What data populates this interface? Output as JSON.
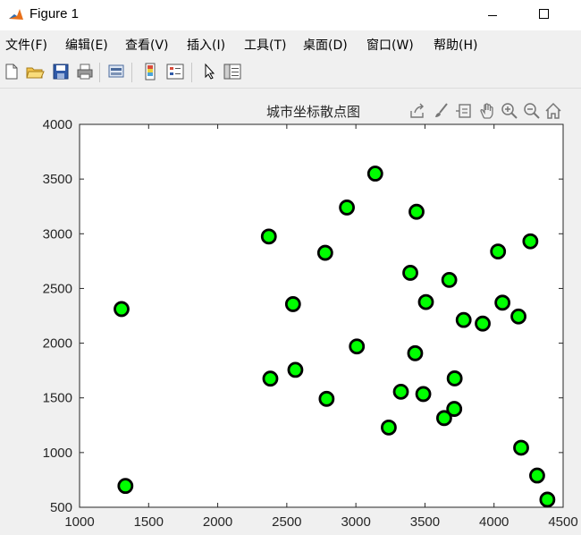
{
  "window": {
    "title": "Figure 1",
    "icon": "matlab-icon",
    "controls": [
      "minimize-icon",
      "maximize-icon"
    ]
  },
  "menu": [
    {
      "label": "文件(F)"
    },
    {
      "label": "编辑(E)"
    },
    {
      "label": "查看(V)"
    },
    {
      "label": "插入(I)"
    },
    {
      "label": "工具(T)"
    },
    {
      "label": "桌面(D)"
    },
    {
      "label": "窗口(W)"
    },
    {
      "label": "帮助(H)"
    }
  ],
  "toolbar": [
    "new-figure-icon",
    "open-file-icon",
    "save-icon",
    "print-icon",
    "link-plot-icon",
    "insert-colorbar-icon",
    "insert-legend-icon",
    "edit-plot-arrow-icon",
    "property-inspector-icon"
  ],
  "axes_toolbar": [
    "export-icon",
    "brush-icon",
    "data-tips-icon",
    "pan-icon",
    "zoom-in-icon",
    "zoom-out-icon",
    "home-icon"
  ],
  "colors": {
    "marker_face": "#00ff00",
    "marker_edge": "#000000",
    "axes_bg": "#ffffff",
    "figure_bg": "#f0f0f0"
  },
  "chart_data": {
    "type": "scatter",
    "title": "城市坐标散点图",
    "xlabel": "",
    "ylabel": "",
    "xlim": [
      1000,
      4500
    ],
    "ylim": [
      500,
      4000
    ],
    "xticks": [
      1000,
      1500,
      2000,
      2500,
      3000,
      3500,
      4000,
      4500
    ],
    "yticks": [
      500,
      1000,
      1500,
      2000,
      2500,
      3000,
      3500,
      4000
    ],
    "grid": false,
    "points": [
      {
        "x": 1304,
        "y": 2312
      },
      {
        "x": 3639,
        "y": 1315
      },
      {
        "x": 4177,
        "y": 2244
      },
      {
        "x": 3712,
        "y": 1399
      },
      {
        "x": 3488,
        "y": 1535
      },
      {
        "x": 3326,
        "y": 1556
      },
      {
        "x": 3238,
        "y": 1229
      },
      {
        "x": 4196,
        "y": 1044
      },
      {
        "x": 4312,
        "y": 790
      },
      {
        "x": 4386,
        "y": 570
      },
      {
        "x": 3007,
        "y": 1970
      },
      {
        "x": 2562,
        "y": 1756
      },
      {
        "x": 2788,
        "y": 1491
      },
      {
        "x": 2381,
        "y": 1676
      },
      {
        "x": 1332,
        "y": 695
      },
      {
        "x": 3715,
        "y": 1678
      },
      {
        "x": 3918,
        "y": 2179
      },
      {
        "x": 4061,
        "y": 2370
      },
      {
        "x": 3780,
        "y": 2212
      },
      {
        "x": 3676,
        "y": 2578
      },
      {
        "x": 4029,
        "y": 2838
      },
      {
        "x": 4263,
        "y": 2931
      },
      {
        "x": 3429,
        "y": 1908
      },
      {
        "x": 3507,
        "y": 2376
      },
      {
        "x": 3394,
        "y": 2643
      },
      {
        "x": 3439,
        "y": 3201
      },
      {
        "x": 2935,
        "y": 3240
      },
      {
        "x": 3140,
        "y": 3550
      },
      {
        "x": 2545,
        "y": 2357
      },
      {
        "x": 2778,
        "y": 2826
      },
      {
        "x": 2370,
        "y": 2975
      }
    ]
  }
}
